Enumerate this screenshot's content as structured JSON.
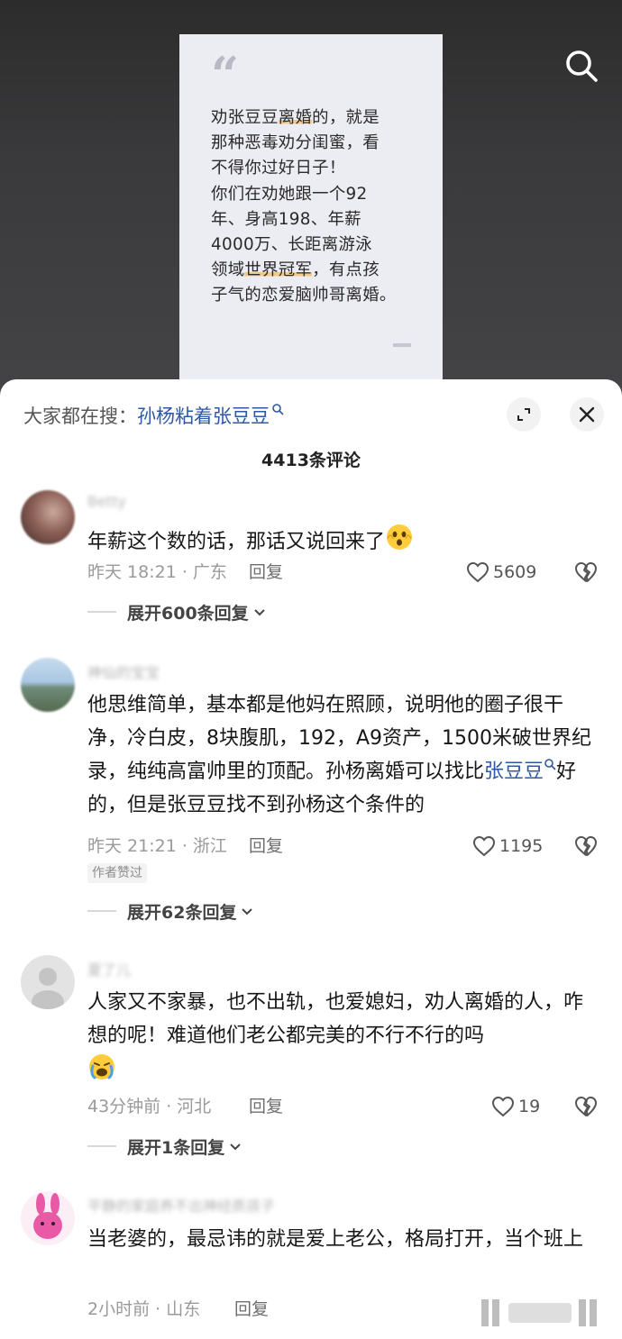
{
  "quote_card": {
    "mark": "“",
    "line1_a": "劝张豆豆",
    "line1_hl": "离婚",
    "line1_b": "的，就是",
    "line2": "那种恶毒劝分闺蜜，看",
    "line3": "不得你过好日子！",
    "line4": "你们在劝她跟一个92",
    "line5": "年、身高198、年薪",
    "line6": "4000万、长距离游泳",
    "line7_a": "领域",
    "line7_hl": "世界冠军",
    "line7_b": "，有点孩",
    "line8": "子气的恋爱脑帅哥离婚。"
  },
  "search_hint": {
    "prefix": "大家都在搜：",
    "keyword": "孙杨粘着张豆豆",
    "icon": "search-small-icon"
  },
  "comments_title": "4413条评论",
  "comments": [
    {
      "username": "Betty",
      "text": "年薪这个数的话，那话又说回来了",
      "emoji": "shocked-face",
      "time_loc": "昨天 18:21 · 广东",
      "reply": "回复",
      "likes": "5609",
      "expand": "展开600条回复"
    },
    {
      "username": "神仙的宝宝",
      "text_a": "他思维简单，基本都是他妈在照顾，说明他的圈子很干净，冷白皮，8块腹肌，192，A9资产，1500米破世界纪录，纯纯高富帅里的顶配。孙杨离婚可以找比",
      "link": "张豆豆",
      "text_b": "好的，但是张豆豆找不到孙杨这个条件的",
      "time_loc": "昨天 21:21 · 浙江",
      "reply": "回复",
      "likes": "1195",
      "tag": "作者赞过",
      "expand": "展开62条回复"
    },
    {
      "username": "夏了儿",
      "text": "人家又不家暴，也不出轨，也爱媳妇，劝人离婚的人，咋想的呢！难道他们老公都完美的不行不行的吗",
      "emoji": "crying-face",
      "time_loc": "43分钟前 · 河北",
      "reply": "回复",
      "likes": "19",
      "expand": "展开1条回复"
    },
    {
      "username": "平静的家庭养不出神经质孩子",
      "text": "当老婆的，最忌讳的就是爱上老公，格局打开，当个班上",
      "time_loc": "2小时前 · 山东",
      "reply": "回复"
    }
  ],
  "colors": {
    "accent_link": "#2c58a6",
    "highlight": "#f4c98d"
  }
}
